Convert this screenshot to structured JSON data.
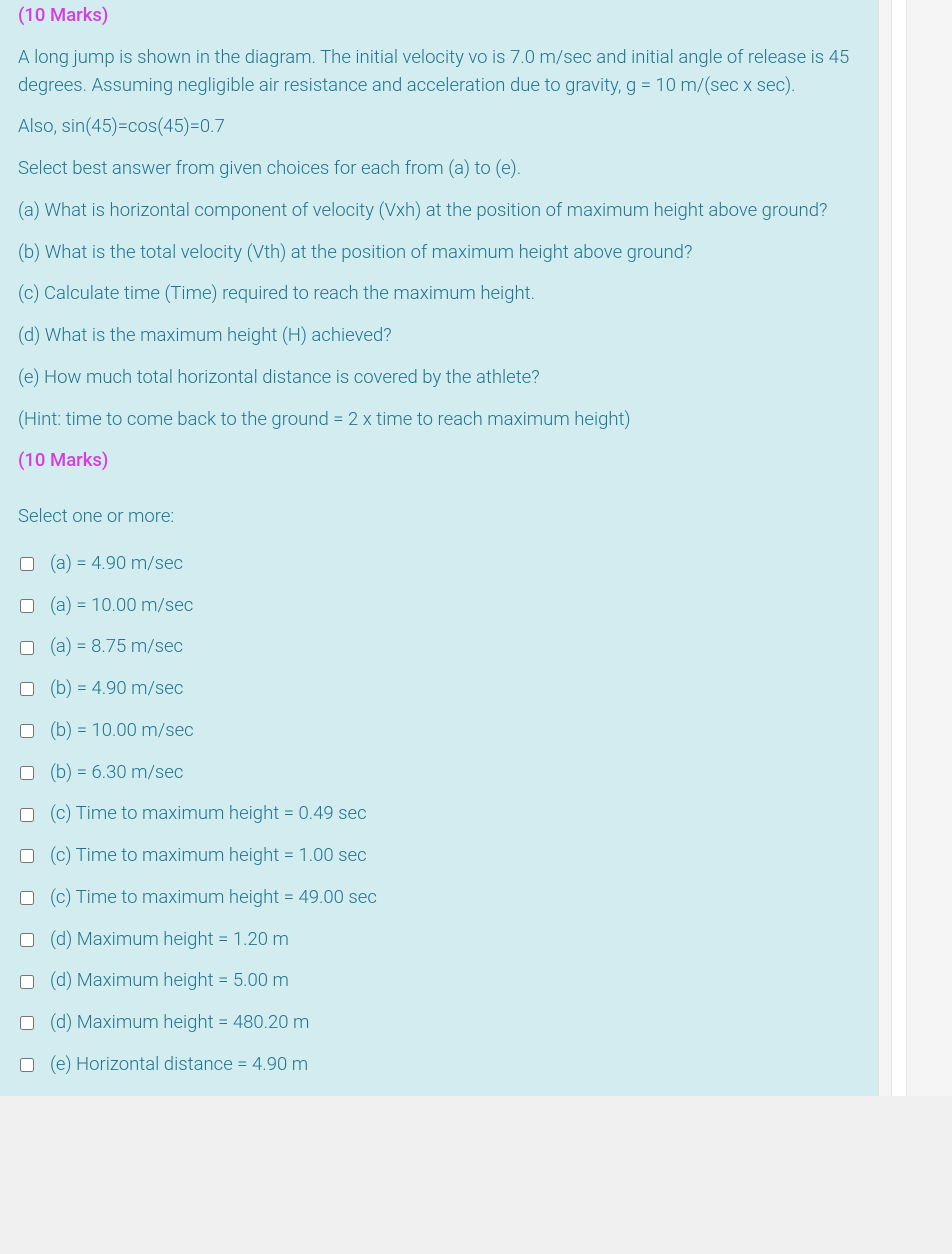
{
  "marks_top": "(10 Marks)",
  "problem_intro": "A long jump is shown in the diagram. The initial velocity vo is 7.0 m/sec and initial angle of release is 45 degrees. Assuming negligible air resistance and acceleration due to gravity, g = 10 m/(sec x sec).",
  "also_line": "Also, sin(45)=cos(45)=0.7",
  "select_line": "Select best answer from given choices for each from (a) to (e).",
  "q_a": "(a) What is horizontal component of velocity (Vxh) at the position of maximum height above ground?",
  "q_b": "(b) What is the total velocity (Vth) at the position of maximum height above ground?",
  "q_c": "(c) Calculate time (Time) required to reach the maximum height.",
  "q_d": "(d) What is the maximum height (H) achieved?",
  "q_e": "(e) How much total horizontal distance is covered by the athlete?",
  "hint": "(Hint: time to come back to the ground = 2 x time to reach maximum height)",
  "marks_bottom": "(10 Marks)",
  "options_intro": "Select one or more:",
  "options": [
    "(a) = 4.90 m/sec",
    "(a) = 10.00 m/sec",
    "(a) = 8.75 m/sec",
    "(b) = 4.90 m/sec",
    "(b) = 10.00 m/sec",
    "(b) = 6.30 m/sec",
    "(c) Time to maximum height = 0.49 sec",
    "(c) Time to maximum height = 1.00 sec",
    "(c) Time to maximum height = 49.00 sec",
    "(d) Maximum height = 1.20 m",
    "(d) Maximum height = 5.00 m",
    "(d) Maximum height = 480.20 m",
    "(e) Horizontal distance = 4.90 m"
  ]
}
